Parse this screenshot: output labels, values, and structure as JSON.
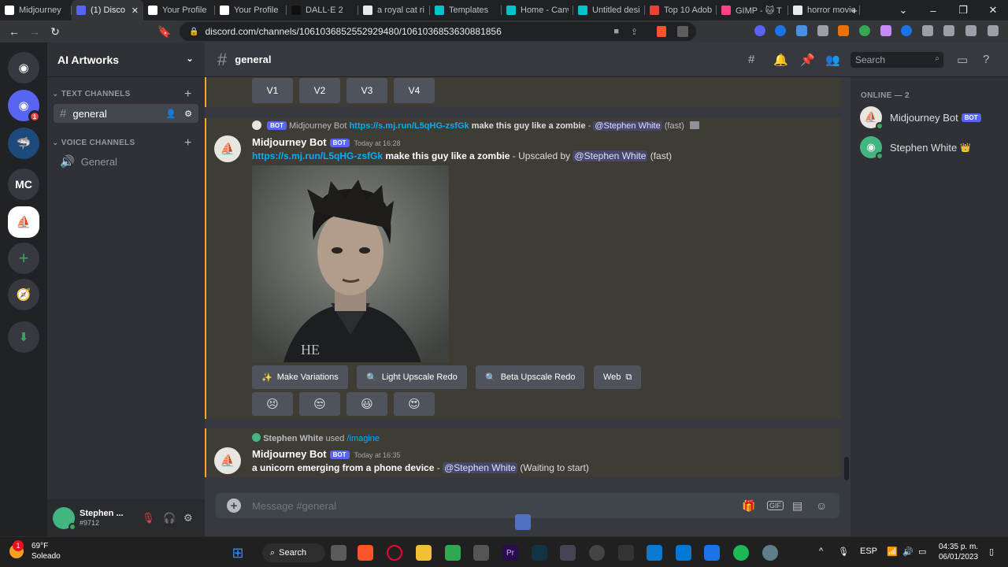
{
  "browser": {
    "tabs": [
      {
        "label": "Midjourney",
        "color": "#ffffff"
      },
      {
        "label": "(1) Disco",
        "color": "#5865f2",
        "active": true
      },
      {
        "label": "Your Profile",
        "color": "#ffffff"
      },
      {
        "label": "Your Profile",
        "color": "#ffffff"
      },
      {
        "label": "DALL·E 2",
        "color": "#111111"
      },
      {
        "label": "a royal cat ri",
        "color": "#e8eaed"
      },
      {
        "label": "Templates",
        "color": "#00c4cc"
      },
      {
        "label": "Home - Canv",
        "color": "#00c4cc"
      },
      {
        "label": "Untitled desi",
        "color": "#00c4cc"
      },
      {
        "label": "Top 10 Adob",
        "color": "#ea4335"
      },
      {
        "label": "GIMP - 🐱 T",
        "color": "#ff4081"
      },
      {
        "label": "horror movie",
        "color": "#e8eaed"
      }
    ],
    "url": "discord.com/channels/1061036852552929480/1061036853630881856"
  },
  "server": {
    "name": "AI Artworks",
    "text_category": "TEXT CHANNELS",
    "voice_category": "VOICE CHANNELS",
    "text_channel": "general",
    "voice_channel": "General",
    "rail": [
      "MC"
    ],
    "notification_count": "1"
  },
  "user": {
    "name": "Stephen ...",
    "tag": "#9712"
  },
  "channel_header": {
    "name": "general",
    "search_placeholder": "Search"
  },
  "messages": {
    "upscale_buttons": [
      "V1",
      "V2",
      "V3",
      "V4"
    ],
    "msg1": {
      "ref_bot": "BOT",
      "ref_name": "Midjourney Bot",
      "ref_link": "https://s.mj.run/L5qHG-zsfGk",
      "ref_prompt": "make this guy like a zombie",
      "ref_dash": " - ",
      "ref_mention": "@Stephen White",
      "ref_speed": "(fast)",
      "author": "Midjourney Bot",
      "bot": "BOT",
      "time": "Today at 16:28",
      "link": "https://s.mj.run/L5qHG-zsfGk",
      "prompt": "make this guy like a zombie",
      "upscaled_by": " - Upscaled by ",
      "mention": "@Stephen White",
      "speed": "(fast)",
      "actions": [
        "Make Variations",
        "Light Upscale Redo",
        "Beta Upscale Redo",
        "Web"
      ],
      "reactions": [
        "😣",
        "😒",
        "😃",
        "😍"
      ]
    },
    "msg2": {
      "ref_user": "Stephen White",
      "ref_used": "used",
      "ref_cmd": "/imagine",
      "author": "Midjourney Bot",
      "bot": "BOT",
      "time": "Today at 16:35",
      "prompt": "a unicorn emerging from a phone device",
      "dash": " - ",
      "mention": "@Stephen White",
      "status": "(Waiting to start)"
    }
  },
  "composer": {
    "placeholder": "Message #general"
  },
  "members": {
    "header": "ONLINE — 2",
    "list": [
      {
        "name": "Midjourney Bot",
        "badge": "BOT"
      },
      {
        "name": "Stephen White",
        "badge": "👑"
      }
    ]
  },
  "taskbar": {
    "temp": "69°F",
    "weather": "Soleado",
    "weather_badge": "1",
    "search": "Search",
    "lang": "ESP",
    "time": "04:35 p. m.",
    "date": "06/01/2023"
  }
}
